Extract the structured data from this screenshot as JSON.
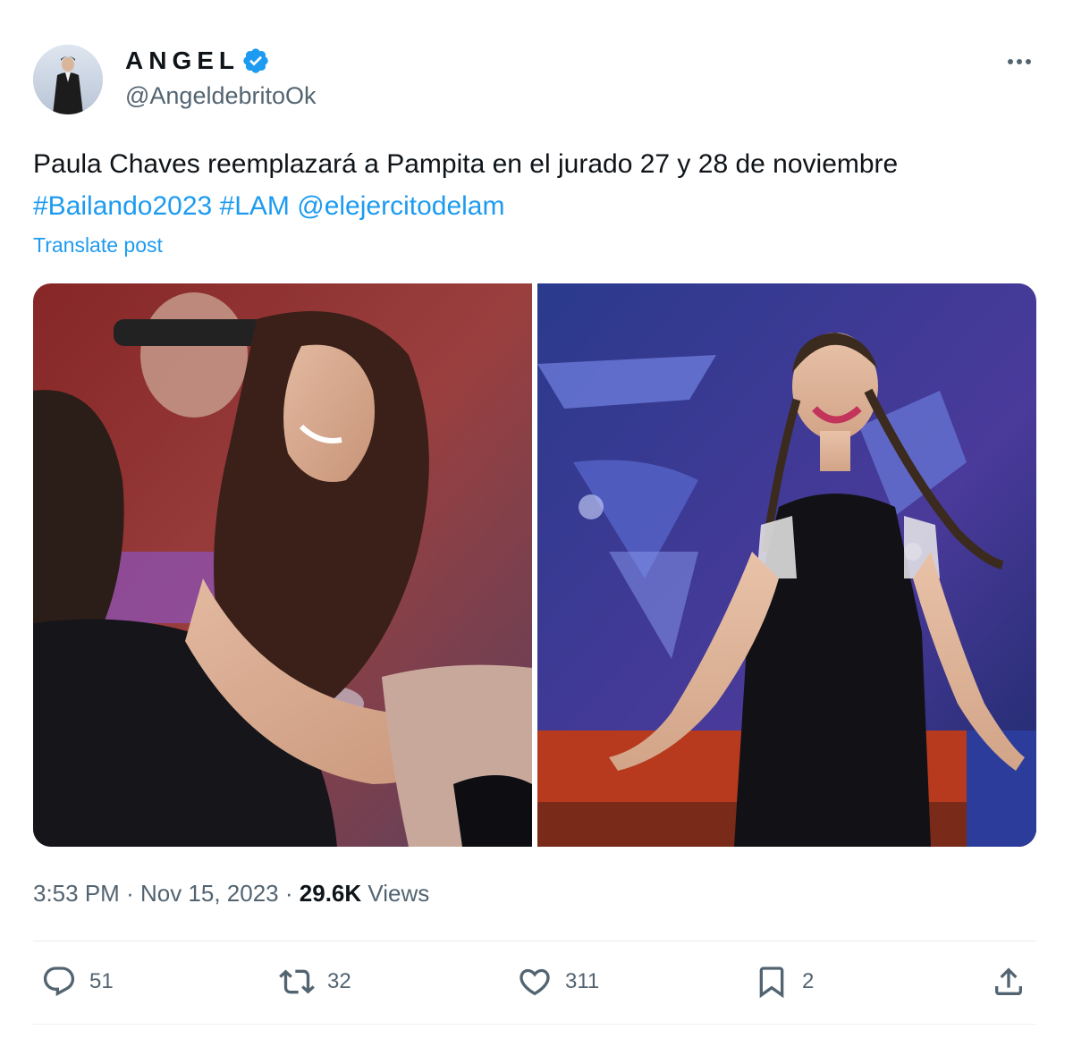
{
  "author": {
    "display_name": "ANGEL",
    "handle": "@AngeldebritoOk",
    "verified": true
  },
  "post": {
    "text": "Paula Chaves reemplazará a Pampita en el jurado 27 y 28 de noviembre",
    "hashtags": [
      "#Bailando2023",
      "#LAM"
    ],
    "mention": "@elejercitodelam",
    "translate_label": "Translate post",
    "images": [
      "photo-woman-laughing-embrace",
      "photo-woman-black-dress-braids"
    ]
  },
  "meta": {
    "time": "3:53 PM",
    "date": "Nov 15, 2023",
    "views_count": "29.6K",
    "views_label": "Views",
    "separator": "·"
  },
  "actions": {
    "replies": "51",
    "reposts": "32",
    "likes": "311",
    "bookmarks": "2"
  },
  "icons": [
    "verified-badge-icon",
    "more-options-icon",
    "reply-icon",
    "repost-icon",
    "like-icon",
    "bookmark-icon",
    "share-icon"
  ],
  "colors": {
    "link": "#1d9bf0",
    "secondary_text": "#536471",
    "primary_text": "#0f1419",
    "verified": "#1d9bf0"
  }
}
